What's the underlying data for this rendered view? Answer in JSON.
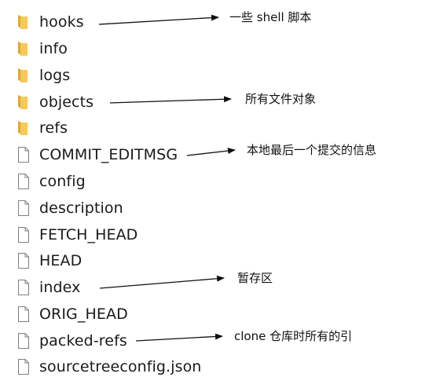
{
  "entries": [
    {
      "name": "hooks",
      "type": "folder",
      "icon": "folder-icon"
    },
    {
      "name": "info",
      "type": "folder",
      "icon": "folder-icon"
    },
    {
      "name": "logs",
      "type": "folder",
      "icon": "folder-icon"
    },
    {
      "name": "objects",
      "type": "folder",
      "icon": "folder-icon"
    },
    {
      "name": "refs",
      "type": "folder",
      "icon": "folder-icon"
    },
    {
      "name": "COMMIT_EDITMSG",
      "type": "file",
      "icon": "file-icon"
    },
    {
      "name": "config",
      "type": "file",
      "icon": "file-icon"
    },
    {
      "name": "description",
      "type": "file",
      "icon": "file-icon"
    },
    {
      "name": "FETCH_HEAD",
      "type": "file",
      "icon": "file-icon"
    },
    {
      "name": "HEAD",
      "type": "file",
      "icon": "file-icon"
    },
    {
      "name": "index",
      "type": "file",
      "icon": "file-icon"
    },
    {
      "name": "ORIG_HEAD",
      "type": "file",
      "icon": "file-icon"
    },
    {
      "name": "packed-refs",
      "type": "file",
      "icon": "file-icon"
    },
    {
      "name": "sourcetreeconfig.json",
      "type": "file",
      "icon": "file-icon"
    }
  ],
  "annotations": [
    {
      "target": "hooks",
      "text": "一些 shell 脚本"
    },
    {
      "target": "objects",
      "text": "所有文件对象"
    },
    {
      "target": "COMMIT_EDITMSG",
      "text": "本地最后一个提交的信息"
    },
    {
      "target": "index",
      "text": "暂存区"
    },
    {
      "target": "packed-refs",
      "text": "clone 仓库时所有的引"
    }
  ],
  "colors": {
    "folder": "#f4c95d",
    "folder_dark": "#e0a82e",
    "file_outline": "#7f7f7f",
    "text": "#1a1a1a",
    "arrow": "#111111"
  }
}
